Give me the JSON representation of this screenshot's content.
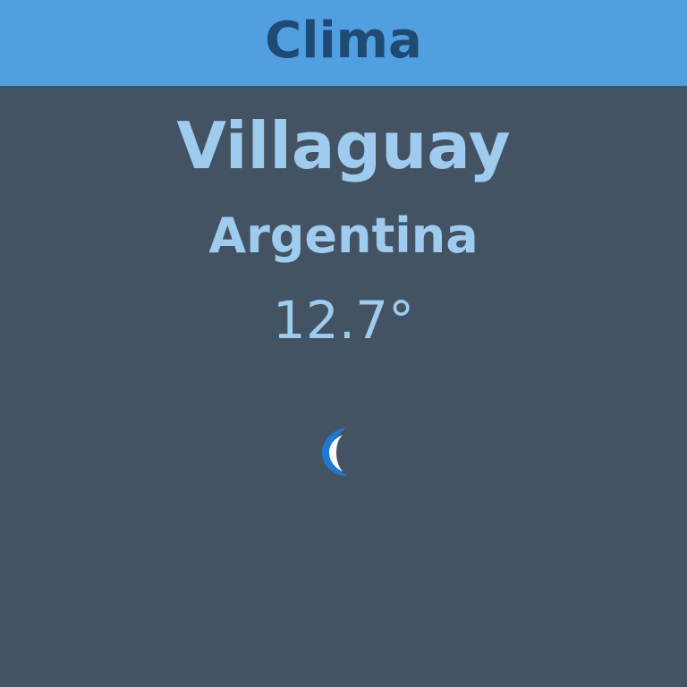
{
  "header": {
    "title": "Clima"
  },
  "weather": {
    "city": "Villaguay",
    "country": "Argentina",
    "temperature": "12.7°",
    "icon": "moon-icon"
  },
  "colors": {
    "header_bg": "#519fe0",
    "header_text": "#1f4a73",
    "page_bg": "#435363",
    "text": "#9fcbef",
    "icon_blue": "#1f78d1"
  }
}
